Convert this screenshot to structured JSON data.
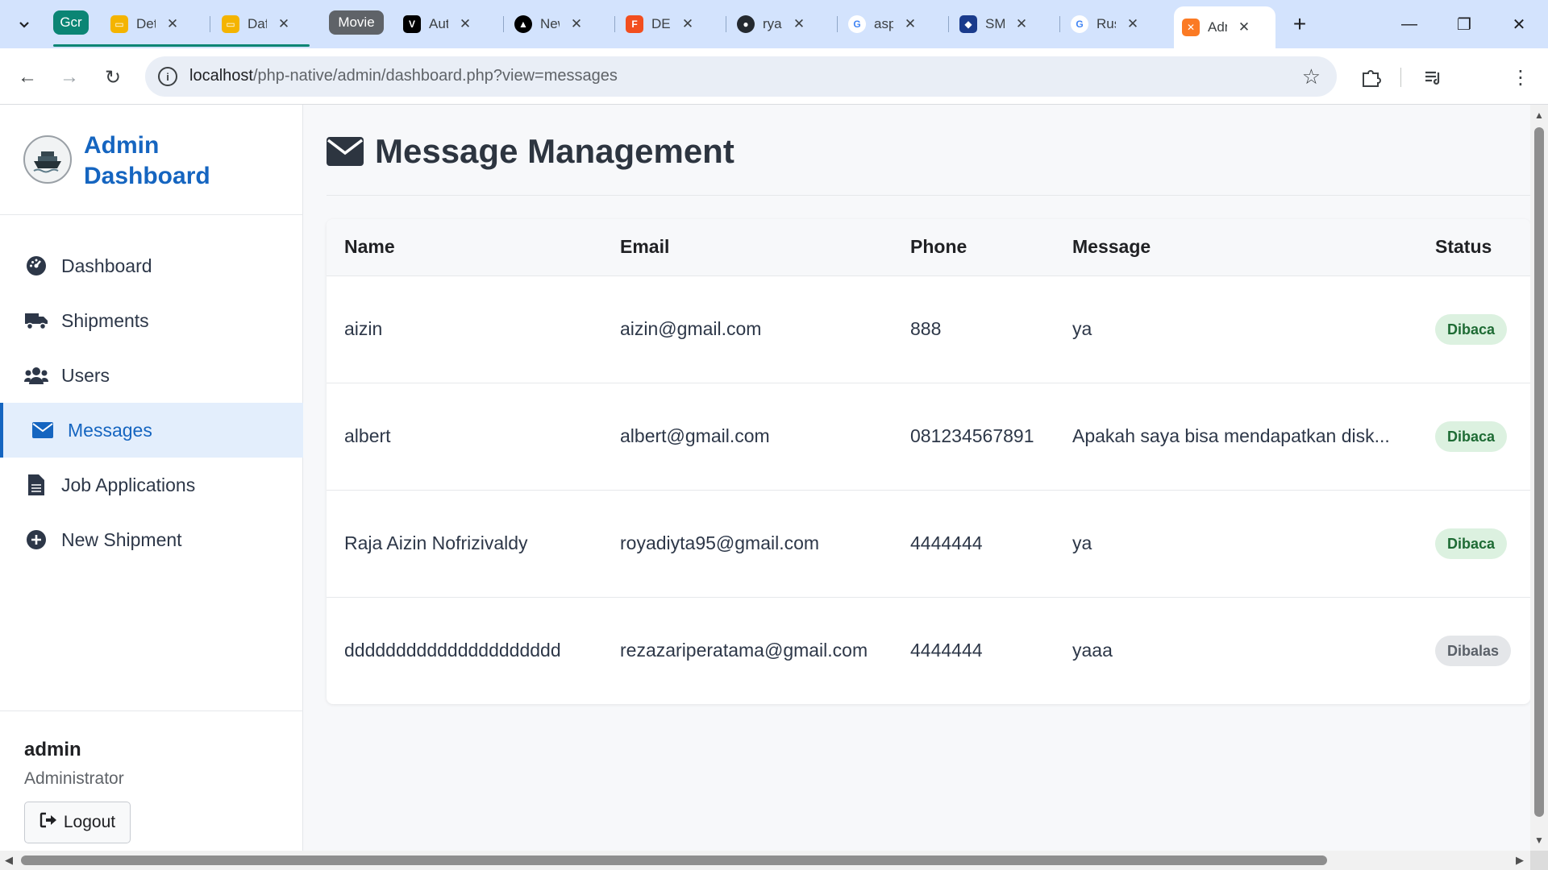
{
  "browser": {
    "tabs": [
      {
        "title": "Det",
        "favicon_color": "#f4b400"
      },
      {
        "title": "Daft",
        "favicon_color": "#f4b400"
      },
      {
        "title": "Aut",
        "favicon_color": "#000000"
      },
      {
        "title": "New",
        "favicon_color": "#000000"
      },
      {
        "title": "DES",
        "favicon_color": "#f24e1e"
      },
      {
        "title": "ryac",
        "favicon_color": "#24292f"
      },
      {
        "title": "aspi",
        "favicon_color": "#4285f4"
      },
      {
        "title": "SMK",
        "favicon_color": "#1a3b8c"
      },
      {
        "title": "Rus",
        "favicon_color": "#4285f4"
      },
      {
        "title": "Adn",
        "favicon_color": "#fb7a24"
      }
    ],
    "groups": [
      {
        "label": "Gcr",
        "color": "#0b8574"
      },
      {
        "label": "Movie",
        "color": "#5f6368"
      }
    ],
    "url_host": "localhost",
    "url_path": "/php-native/admin/dashboard.php?view=messages"
  },
  "sidebar": {
    "brand_title": "Admin Dashboard",
    "items": [
      {
        "label": "Dashboard",
        "icon": "tachometer-icon"
      },
      {
        "label": "Shipments",
        "icon": "truck-icon"
      },
      {
        "label": "Users",
        "icon": "users-icon"
      },
      {
        "label": "Messages",
        "icon": "envelope-icon",
        "active": true
      },
      {
        "label": "Job Applications",
        "icon": "file-icon"
      },
      {
        "label": "New Shipment",
        "icon": "plus-circle-icon"
      }
    ],
    "user": {
      "name": "admin",
      "role": "Administrator"
    },
    "logout_label": "Logout"
  },
  "main": {
    "title": "Message Management",
    "columns": [
      "Name",
      "Email",
      "Phone",
      "Message",
      "Status"
    ],
    "rows": [
      {
        "name": "aizin",
        "email": "aizin@gmail.com",
        "phone": "888",
        "message": "ya",
        "status": "Dibaca",
        "status_type": "read"
      },
      {
        "name": "albert",
        "email": "albert@gmail.com",
        "phone": "081234567891",
        "message": "Apakah saya bisa mendapatkan disk...",
        "status": "Dibaca",
        "status_type": "read"
      },
      {
        "name": "Raja Aizin Nofrizivaldy",
        "email": "royadiyta95@gmail.com",
        "phone": "4444444",
        "message": "ya",
        "status": "Dibaca",
        "status_type": "read"
      },
      {
        "name": "ddddddddddddddddddddd",
        "email": "rezazariperatama@gmail.com",
        "phone": "4444444",
        "message": "yaaa",
        "status": "Dibalas",
        "status_type": "replied"
      }
    ]
  },
  "colors": {
    "accent": "#1565c0",
    "read_badge": "#dcf1e0",
    "replied_badge": "#e4e6e9"
  }
}
